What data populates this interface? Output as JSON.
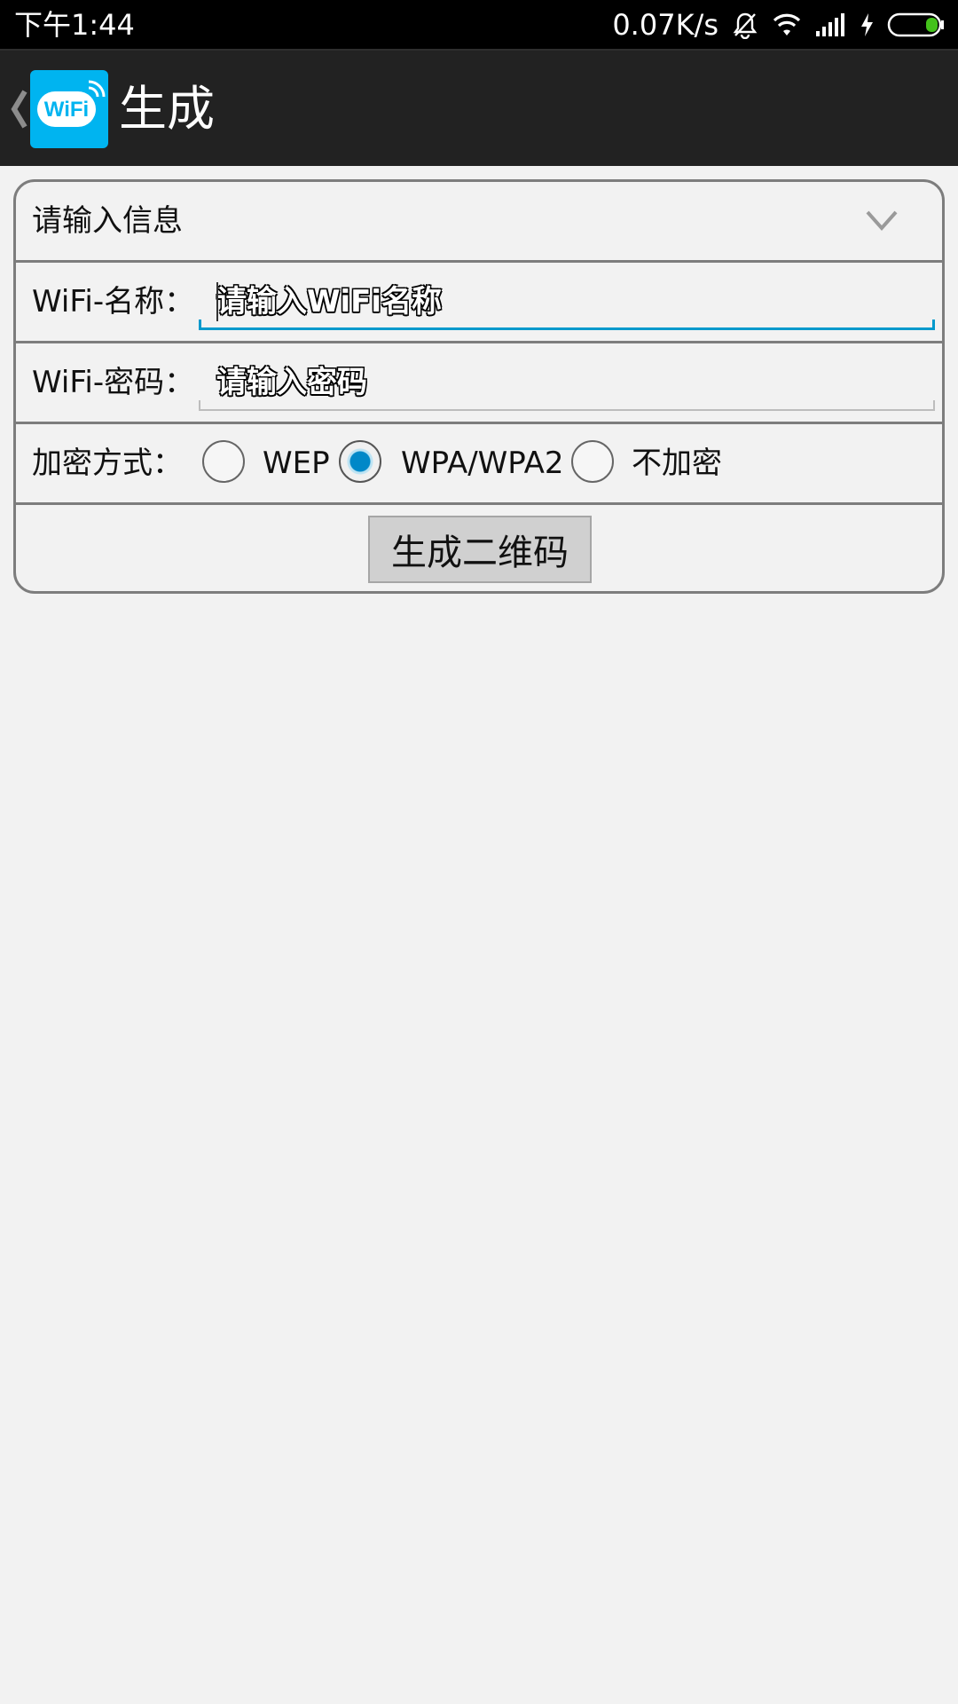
{
  "status_bar": {
    "time": "下午1:44",
    "net_speed": "0.07K/s",
    "icons": [
      "bell-muted-icon",
      "wifi-icon",
      "signal-icon",
      "charging-icon",
      "battery-icon"
    ],
    "battery_color": "#44c21b"
  },
  "action_bar": {
    "title": "生成",
    "app_icon_text": "WiFi",
    "icon_color": "#00b4f0"
  },
  "form": {
    "header": "请输入信息",
    "name_label": "WiFi-名称：",
    "name_placeholder": "请输入WiFi名称",
    "password_label": "WiFi-密码：",
    "password_placeholder": "请输入密码",
    "encryption_label": "加密方式：",
    "encryption_options": [
      {
        "label": "WEP",
        "checked": false
      },
      {
        "label": "WPA/WPA2",
        "checked": true
      },
      {
        "label": "不加密",
        "checked": false
      }
    ],
    "submit_label": "生成二维码",
    "accent_color": "#0099cc"
  }
}
